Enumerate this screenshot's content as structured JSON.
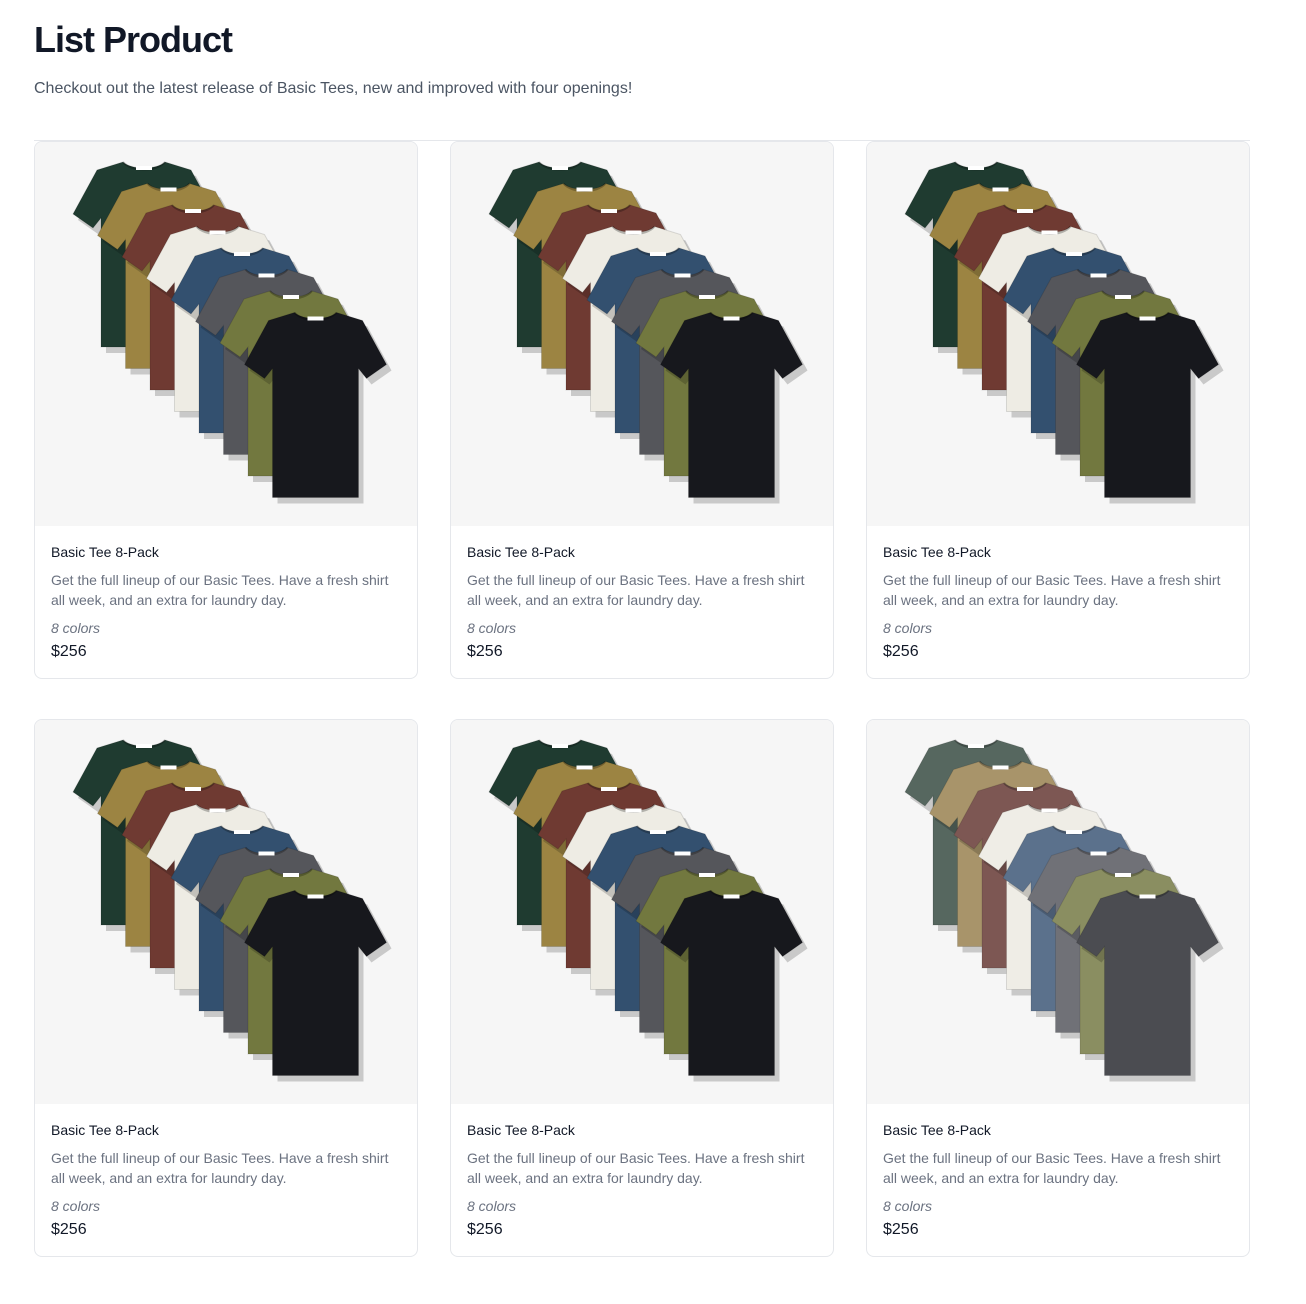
{
  "page": {
    "title": "List Product",
    "subtitle": "Checkout out the latest release of Basic Tees, new and improved with four openings!"
  },
  "products": [
    {
      "name": "Basic Tee 8-Pack",
      "description": "Get the full lineup of our Basic Tees. Have a fresh shirt all week, and an extra for laundry day.",
      "colors": "8 colors",
      "price": "$256",
      "shirt_colors": [
        "#1f3b30",
        "#9c8442",
        "#6f3a32",
        "#eeece4",
        "#33506f",
        "#55565b",
        "#72783f",
        "#17181d"
      ]
    },
    {
      "name": "Basic Tee 8-Pack",
      "description": "Get the full lineup of our Basic Tees. Have a fresh shirt all week, and an extra for laundry day.",
      "colors": "8 colors",
      "price": "$256",
      "shirt_colors": [
        "#1f3b30",
        "#9c8442",
        "#6f3a32",
        "#eeece4",
        "#33506f",
        "#55565b",
        "#72783f",
        "#17181d"
      ]
    },
    {
      "name": "Basic Tee 8-Pack",
      "description": "Get the full lineup of our Basic Tees. Have a fresh shirt all week, and an extra for laundry day.",
      "colors": "8 colors",
      "price": "$256",
      "shirt_colors": [
        "#1f3b30",
        "#9c8442",
        "#6f3a32",
        "#eeece4",
        "#33506f",
        "#55565b",
        "#72783f",
        "#17181d"
      ]
    },
    {
      "name": "Basic Tee 8-Pack",
      "description": "Get the full lineup of our Basic Tees. Have a fresh shirt all week, and an extra for laundry day.",
      "colors": "8 colors",
      "price": "$256",
      "shirt_colors": [
        "#1f3b30",
        "#9c8442",
        "#6f3a32",
        "#eeece4",
        "#33506f",
        "#55565b",
        "#72783f",
        "#17181d"
      ]
    },
    {
      "name": "Basic Tee 8-Pack",
      "description": "Get the full lineup of our Basic Tees. Have a fresh shirt all week, and an extra for laundry day.",
      "colors": "8 colors",
      "price": "$256",
      "shirt_colors": [
        "#1f3b30",
        "#9c8442",
        "#6f3a32",
        "#eeece4",
        "#33506f",
        "#55565b",
        "#72783f",
        "#17181d"
      ]
    },
    {
      "name": "Basic Tee 8-Pack",
      "description": "Get the full lineup of our Basic Tees. Have a fresh shirt all week, and an extra for laundry day.",
      "colors": "8 colors",
      "price": "$256",
      "shirt_colors": [
        "#56675f",
        "#a8946a",
        "#7d5753",
        "#efede6",
        "#5b718c",
        "#707177",
        "#8a8e61",
        "#4b4c51"
      ]
    }
  ]
}
